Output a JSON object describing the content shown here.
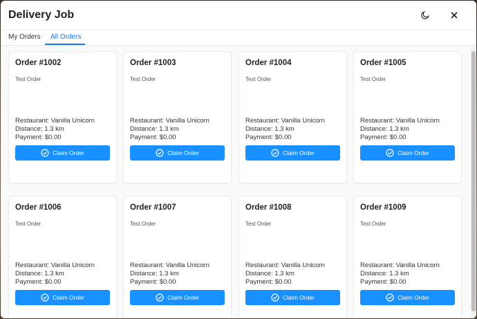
{
  "header": {
    "title": "Delivery Job",
    "theme_icon": "moon-icon",
    "close_icon": "close-icon"
  },
  "tabs": [
    {
      "label": "My Orders",
      "active": false
    },
    {
      "label": "All Orders",
      "active": true
    }
  ],
  "colors": {
    "accent": "#1677ff",
    "button": "#1890ff"
  },
  "orders": [
    {
      "title": "Order #1002",
      "desc": "Test Order",
      "restaurant": "Restaurant: Vanilla Unicorn",
      "distance": "Distance: 1.3 km",
      "payment": "Payment: $0.00",
      "button": "Claim Order"
    },
    {
      "title": "Order #1003",
      "desc": "Test Order",
      "restaurant": "Restaurant: Vanilla Unicorn",
      "distance": "Distance: 1.3 km",
      "payment": "Payment: $0.00",
      "button": "Claim Order"
    },
    {
      "title": "Order #1004",
      "desc": "Test Order",
      "restaurant": "Restaurant: Vanilla Unicorn",
      "distance": "Distance: 1.3 km",
      "payment": "Payment: $0.00",
      "button": "Claim Order"
    },
    {
      "title": "Order #1005",
      "desc": "Test Order",
      "restaurant": "Restaurant: Vanilla Unicorn",
      "distance": "Distance: 1.3 km",
      "payment": "Payment: $0.00",
      "button": "Claim Order"
    },
    {
      "title": "Order #1006",
      "desc": "Test Order",
      "restaurant": "Restaurant: Vanilla Unicorn",
      "distance": "Distance: 1.3 km",
      "payment": "Payment: $0.00",
      "button": "Claim Order"
    },
    {
      "title": "Order #1007",
      "desc": "Test Order",
      "restaurant": "Restaurant: Vanilla Unicorn",
      "distance": "Distance: 1.3 km",
      "payment": "Payment: $0.00",
      "button": "Claim Order"
    },
    {
      "title": "Order #1008",
      "desc": "Test Order",
      "restaurant": "Restaurant: Vanilla Unicorn",
      "distance": "Distance: 1.3 km",
      "payment": "Payment: $0.00",
      "button": "Claim Order"
    },
    {
      "title": "Order #1009",
      "desc": "Test Order",
      "restaurant": "Restaurant: Vanilla Unicorn",
      "distance": "Distance: 1.3 km",
      "payment": "Payment: $0.00",
      "button": "Claim Order"
    }
  ]
}
